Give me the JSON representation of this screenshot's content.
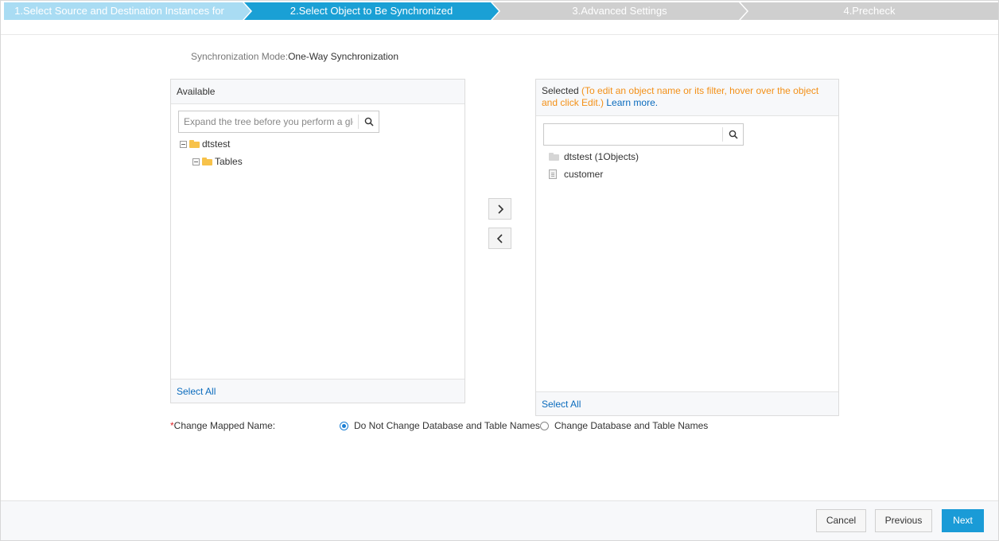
{
  "steps": [
    {
      "label": "1.Select Source and Destination Instances for"
    },
    {
      "label": "2.Select Object to Be Synchronized"
    },
    {
      "label": "3.Advanced Settings"
    },
    {
      "label": "4.Precheck"
    }
  ],
  "sync_mode": {
    "label": "Synchronization Mode:",
    "value": "One-Way Synchronization"
  },
  "available": {
    "title": "Available",
    "search_placeholder": "Expand the tree before you perform a global search.",
    "tree": [
      {
        "label": "dtstest"
      },
      {
        "label": "Tables"
      }
    ],
    "select_all": "Select All"
  },
  "selected": {
    "title": "Selected",
    "hint": "(To edit an object name or its filter, hover over the object and click Edit.)",
    "learn_more": "Learn more.",
    "search_value": "",
    "items": [
      {
        "label": "dtstest (1Objects)"
      },
      {
        "label": "customer"
      }
    ],
    "select_all": "Select All"
  },
  "mapped_name": {
    "required_mark": "*",
    "label": "Change Mapped Name:",
    "options": [
      {
        "label": "Do Not Change Database and Table Names",
        "checked": true
      },
      {
        "label": "Change Database and Table Names",
        "checked": false
      }
    ]
  },
  "footer": {
    "cancel": "Cancel",
    "previous": "Previous",
    "next": "Next"
  },
  "icons": {
    "search": "search-icon",
    "add": "chevron-right-icon",
    "remove": "chevron-left-icon",
    "collapse": "minus-square-icon",
    "folder": "folder-icon",
    "table": "table-file-icon"
  },
  "colors": {
    "step_done": "#a9dcf3",
    "step_active": "#1aa0d5",
    "step_pending": "#cfcfcf",
    "primary": "#1a9bd7",
    "link": "#0a6bbd",
    "hint": "#f39017",
    "required": "#e0262a"
  }
}
